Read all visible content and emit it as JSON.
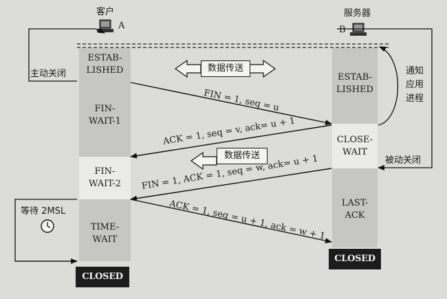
{
  "client": {
    "title": "客户",
    "letter": "A"
  },
  "server": {
    "title": "服务器",
    "letter": "B"
  },
  "client_states": {
    "established": "ESTAB-\nLISHED",
    "fin_wait_1": "FIN-\nWAIT-1",
    "fin_wait_2": "FIN-\nWAIT-2",
    "time_wait": "TIME-\nWAIT",
    "closed": "CLOSED"
  },
  "server_states": {
    "established": "ESTAB-\nLISHED",
    "close_wait": "CLOSE-\nWAIT",
    "last_ack": "LAST-\nACK",
    "closed": "CLOSED"
  },
  "messages": {
    "fin1": "FIN = 1, seq = u",
    "ack1": "ACK = 1, seq = v, ack= u + 1",
    "fin2": "FIN = 1, ACK = 1, seq = w, ack= u + 1",
    "ack2": "ACK = 1, seq = u + 1, ack = w + 1"
  },
  "labels": {
    "active_close": "主动关闭",
    "passive_close": "被动关闭",
    "notify_app": "通知\n应用\n进程",
    "wait_2msl": "等待 2MSL",
    "data_transfer_1": "数据传送",
    "data_transfer_2": "数据传送"
  },
  "icons": {
    "computer": "computer-icon",
    "clock": "clock-icon"
  }
}
